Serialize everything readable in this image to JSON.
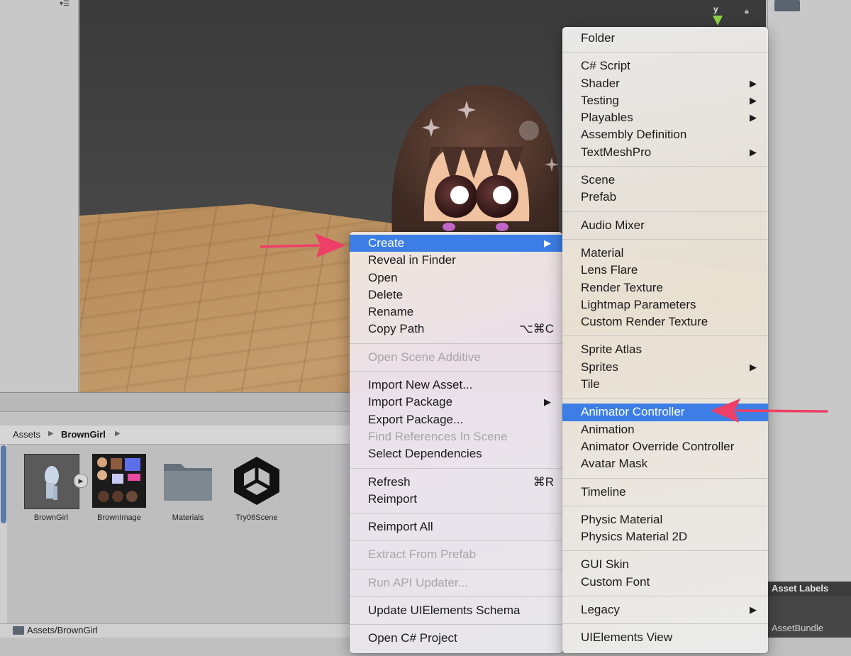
{
  "scene": {
    "gizmo_axis_label": "y"
  },
  "project": {
    "breadcrumb": [
      "Assets",
      "BrownGirl"
    ],
    "assets": [
      {
        "name": "BrownGirl",
        "icon": "model-icon"
      },
      {
        "name": "BrownImage",
        "icon": "texture-icon"
      },
      {
        "name": "Materials",
        "icon": "folder-icon"
      },
      {
        "name": "Try06Scene",
        "icon": "unity-scene-icon"
      }
    ],
    "path": "Assets/BrownGirl"
  },
  "inspector": {
    "asset_labels": "Asset Labels",
    "asset_bundle": "AssetBundle"
  },
  "context_menu": {
    "items": [
      {
        "label": "Create",
        "highlighted": true,
        "submenu": true
      },
      {
        "label": "Reveal in Finder"
      },
      {
        "label": "Open"
      },
      {
        "label": "Delete"
      },
      {
        "label": "Rename"
      },
      {
        "label": "Copy Path",
        "shortcut": "⌥⌘C"
      },
      {
        "label": "Open Scene Additive",
        "disabled": true
      },
      {
        "label": "Import New Asset..."
      },
      {
        "label": "Import Package",
        "submenu": true
      },
      {
        "label": "Export Package..."
      },
      {
        "label": "Find References In Scene",
        "disabled": true
      },
      {
        "label": "Select Dependencies"
      },
      {
        "label": "Refresh",
        "shortcut": "⌘R"
      },
      {
        "label": "Reimport"
      },
      {
        "label": "Reimport All"
      },
      {
        "label": "Extract From Prefab",
        "disabled": true
      },
      {
        "label": "Run API Updater...",
        "disabled": true
      },
      {
        "label": "Update UIElements Schema"
      },
      {
        "label": "Open C# Project"
      }
    ]
  },
  "create_submenu": {
    "items": [
      {
        "label": "Folder"
      },
      {
        "label": "C# Script"
      },
      {
        "label": "Shader",
        "submenu": true
      },
      {
        "label": "Testing",
        "submenu": true
      },
      {
        "label": "Playables",
        "submenu": true
      },
      {
        "label": "Assembly Definition"
      },
      {
        "label": "TextMeshPro",
        "submenu": true
      },
      {
        "label": "Scene"
      },
      {
        "label": "Prefab"
      },
      {
        "label": "Audio Mixer"
      },
      {
        "label": "Material"
      },
      {
        "label": "Lens Flare"
      },
      {
        "label": "Render Texture"
      },
      {
        "label": "Lightmap Parameters"
      },
      {
        "label": "Custom Render Texture"
      },
      {
        "label": "Sprite Atlas"
      },
      {
        "label": "Sprites",
        "submenu": true
      },
      {
        "label": "Tile"
      },
      {
        "label": "Animator Controller",
        "highlighted": true
      },
      {
        "label": "Animation"
      },
      {
        "label": "Animator Override Controller"
      },
      {
        "label": "Avatar Mask"
      },
      {
        "label": "Timeline"
      },
      {
        "label": "Physic Material"
      },
      {
        "label": "Physics Material 2D"
      },
      {
        "label": "GUI Skin"
      },
      {
        "label": "Custom Font"
      },
      {
        "label": "Legacy",
        "submenu": true
      },
      {
        "label": "UIElements View"
      }
    ]
  },
  "colors": {
    "highlight": "#3c7ee6",
    "annotation_arrow": "#ee3f66"
  }
}
